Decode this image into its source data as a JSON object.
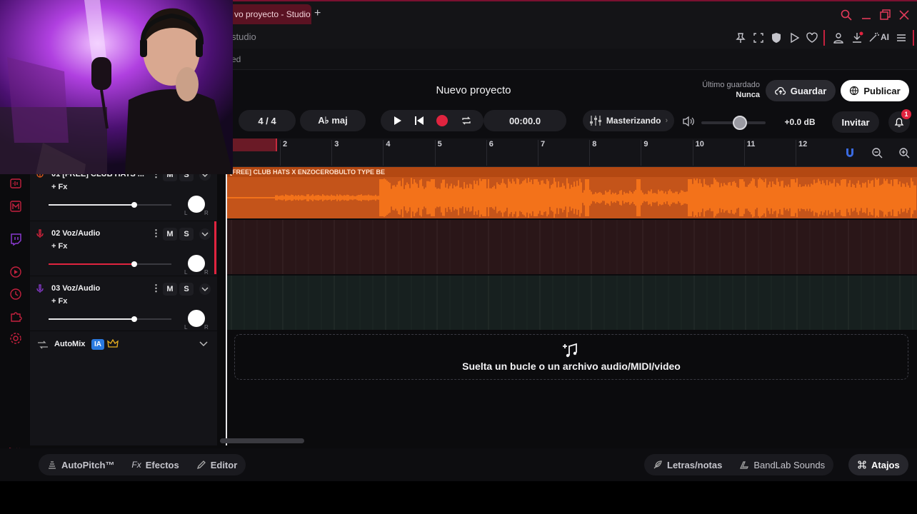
{
  "browser": {
    "tab_title": "vo proyecto - Studio",
    "address_fragment": "studio",
    "bookmark_fragment": "ed",
    "toolbar_icons": [
      "pin-icon",
      "screenshot-icon",
      "shield-icon",
      "play-icon",
      "heart-icon",
      "profile-icon",
      "download-icon",
      "ai-wand-icon",
      "menu-icon"
    ],
    "ai_label": "AI"
  },
  "header": {
    "project_title": "Nuevo proyecto",
    "last_saved_label": "Último guardado",
    "last_saved_value": "Nunca",
    "save_label": "Guardar",
    "publish_label": "Publicar"
  },
  "transport": {
    "time_signature": "4 / 4",
    "key": "A♭ maj",
    "timecode": "00:00.0",
    "mastering_label": "Masterizando",
    "volume_db": "+0.0 dB",
    "volume_level_fraction": 0.6,
    "invite_label": "Invitar",
    "notifications_count": "1"
  },
  "ruler": {
    "bars": [
      "2",
      "3",
      "4",
      "5",
      "6",
      "7",
      "8",
      "9",
      "10",
      "11",
      "12"
    ]
  },
  "tracks": [
    {
      "name": "01  [FREE] CLUB HATS ...",
      "mute": "M",
      "solo": "S",
      "fx": "+ Fx",
      "volume_fraction": 0.7,
      "color": "#e05a1a",
      "icon": "waveform-icon"
    },
    {
      "name": "02  Voz/Audio",
      "mute": "M",
      "solo": "S",
      "fx": "+ Fx",
      "volume_fraction": 0.7,
      "color": "#e0243f",
      "icon": "mic-icon"
    },
    {
      "name": "03  Voz/Audio",
      "mute": "M",
      "solo": "S",
      "fx": "+ Fx",
      "volume_fraction": 0.7,
      "color": "#8a3ad0",
      "icon": "mic-icon"
    }
  ],
  "pan_labels": {
    "left": "L",
    "right": "R"
  },
  "automix": {
    "label": "AutoMix",
    "badge": "IA"
  },
  "clip": {
    "title": "[FREE] CLUB HATS X ENZOCEROBULTO TYPE BE"
  },
  "dropzone": {
    "text": "Suelta un bucle o un archivo audio/MIDI/video"
  },
  "bottom": {
    "autopitch": "AutoPitch™",
    "effects": "Efectos",
    "effects_prefix": "Fx",
    "editor": "Editor",
    "lyrics": "Letras/notas",
    "sounds": "BandLab Sounds",
    "shortcuts": "Atajos"
  },
  "colors": {
    "accent": "#e0243f",
    "clip": "#c4541a",
    "waveform": "#ff7a1a"
  }
}
